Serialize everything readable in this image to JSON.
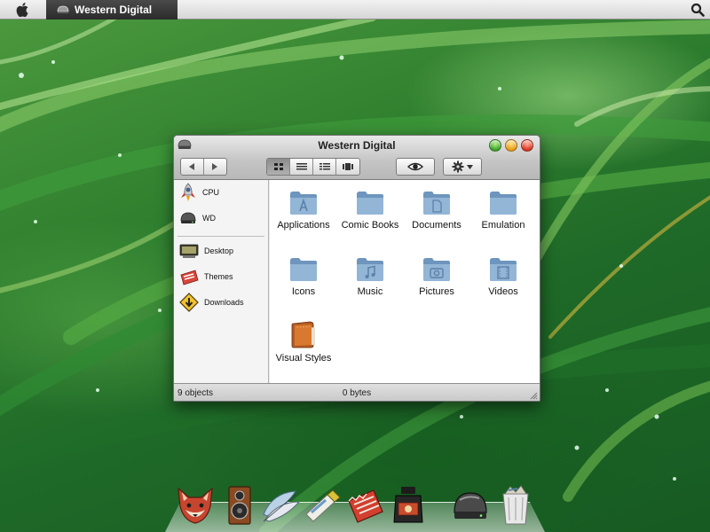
{
  "menubar": {
    "apple_icon": "apple-icon",
    "active_app": "Western Digital",
    "search_icon": "search-icon"
  },
  "window": {
    "title": "Western Digital",
    "toolbar": {
      "back_icon": "back-arrow-icon",
      "forward_icon": "forward-arrow-icon",
      "view_modes": [
        "icon-view",
        "list-view",
        "column-view",
        "cover-flow-view"
      ],
      "active_view": "icon-view",
      "quicklook_icon": "eye-icon",
      "action_icon": "gear-icon"
    },
    "sidebar": {
      "devices": [
        {
          "label": "CPU",
          "icon": "rocket-icon"
        },
        {
          "label": "WD",
          "icon": "hard-drive-icon"
        }
      ],
      "places": [
        {
          "label": "Desktop",
          "icon": "monitor-icon"
        },
        {
          "label": "Themes",
          "icon": "themes-icon"
        },
        {
          "label": "Downloads",
          "icon": "downloads-icon"
        }
      ]
    },
    "files": [
      {
        "label": "Applications",
        "icon": "applications-folder-icon"
      },
      {
        "label": "Comic Books",
        "icon": "folder-icon"
      },
      {
        "label": "Documents",
        "icon": "documents-folder-icon"
      },
      {
        "label": "Emulation",
        "icon": "folder-icon"
      },
      {
        "label": "Icons",
        "icon": "folder-icon"
      },
      {
        "label": "Music",
        "icon": "music-folder-icon"
      },
      {
        "label": "Pictures",
        "icon": "pictures-folder-icon"
      },
      {
        "label": "Videos",
        "icon": "videos-folder-icon"
      },
      {
        "label": "Visual Styles",
        "icon": "leather-folder-icon"
      }
    ],
    "status": {
      "count": "9 objects",
      "size": "0 bytes"
    }
  },
  "dock": [
    {
      "icon": "fox-icon"
    },
    {
      "icon": "speaker-icon"
    },
    {
      "icon": "feathers-icon"
    },
    {
      "icon": "paint-tube-icon"
    },
    {
      "icon": "torn-box-icon"
    },
    {
      "icon": "ink-bottle-icon"
    },
    {
      "icon": "hard-drive-icon"
    },
    {
      "icon": "trash-icon"
    }
  ],
  "colors": {
    "folder_blue": "#7fa3c6",
    "window_chrome": "#c4c4c4",
    "menubar_active": "#2b2b2b"
  }
}
